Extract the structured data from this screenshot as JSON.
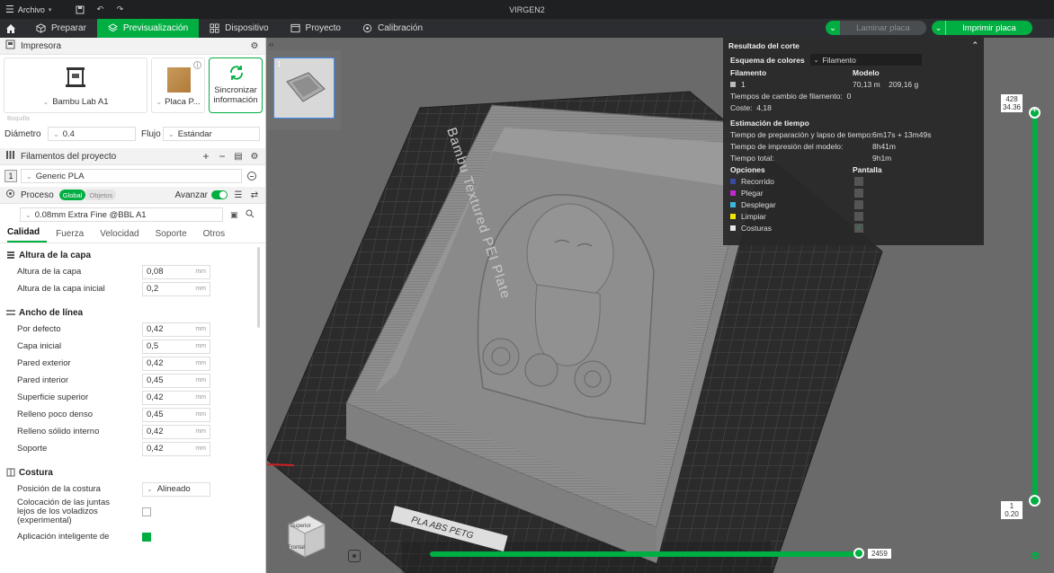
{
  "titlebar": {
    "menu_label": "Archivo",
    "title": "VIRGEN2"
  },
  "toolbar": {
    "tabs": [
      {
        "label": "Preparar"
      },
      {
        "label": "Previsualización"
      },
      {
        "label": "Dispositivo"
      },
      {
        "label": "Proyecto"
      },
      {
        "label": "Calibración"
      }
    ],
    "slice_label": "Laminar placa",
    "print_label": "Imprimir placa"
  },
  "printer": {
    "section_title": "Impresora",
    "printer_name": "Bambu Lab A1",
    "plate_name": "Placa P...",
    "sync_label_1": "Sincronizar",
    "sync_label_2": "información",
    "nozzle_label": "Boquilla",
    "diameter_label": "Diámetro",
    "diameter_value": "0.4",
    "flow_label": "Flujo",
    "flow_value": "Estándar"
  },
  "filaments": {
    "section_title": "Filamentos del proyecto",
    "items": [
      {
        "index": "1",
        "name": "Generic PLA"
      }
    ]
  },
  "process": {
    "section_title": "Proceso",
    "toggle_global": "Global",
    "toggle_objects": "Objetos",
    "advanced_label": "Avanzar",
    "profile": "0.08mm Extra Fine @BBL A1",
    "tabs": [
      "Calidad",
      "Fuerza",
      "Velocidad",
      "Soporte",
      "Otros"
    ]
  },
  "params": {
    "layer_height": {
      "title": "Altura de la capa",
      "rows": [
        {
          "label": "Altura de la capa",
          "value": "0,08",
          "unit": "mm"
        },
        {
          "label": "Altura de la capa inicial",
          "value": "0,2",
          "unit": "mm"
        }
      ]
    },
    "line_width": {
      "title": "Ancho de línea",
      "rows": [
        {
          "label": "Por defecto",
          "value": "0,42",
          "unit": "mm"
        },
        {
          "label": "Capa inicial",
          "value": "0,5",
          "unit": "mm"
        },
        {
          "label": "Pared exterior",
          "value": "0,42",
          "unit": "mm"
        },
        {
          "label": "Pared interior",
          "value": "0,45",
          "unit": "mm"
        },
        {
          "label": "Superficie superior",
          "value": "0,42",
          "unit": "mm"
        },
        {
          "label": "Relleno poco denso",
          "value": "0,45",
          "unit": "mm"
        },
        {
          "label": "Relleno sólido interno",
          "value": "0,42",
          "unit": "mm"
        },
        {
          "label": "Soporte",
          "value": "0,42",
          "unit": "mm"
        }
      ]
    },
    "seam": {
      "title": "Costura",
      "position_label": "Posición de la costura",
      "position_value": "Alineado",
      "staggered_label_1": "Colocación de las juntas",
      "staggered_label_2": "lejos de los voladizos",
      "staggered_label_3": "(experimental)",
      "smart_label": "Aplicación inteligente de"
    }
  },
  "viewport": {
    "thumb_index": "1",
    "plate_text": "Bambu Textured PEI Plate",
    "plate_sticker": "PLA ABS PETG",
    "cube_top": "Superior",
    "cube_front": "Frontal",
    "layer_top": "428",
    "layer_top_height": "34.36",
    "layer_bottom": "1",
    "layer_bottom_height": "0.20",
    "move_value": "2459"
  },
  "result": {
    "title": "Resultado del corte",
    "scheme_label": "Esquema de colores",
    "scheme_value": "Filamento",
    "col_filament": "Filamento",
    "col_model": "Modelo",
    "filament_index": "1",
    "filament_model": "70,13 m    209,16 g",
    "change_times": "Tiempos de cambio de filamento:  0",
    "cost": "Coste:  4,18",
    "time_title": "Estimación de tiempo",
    "prep_label": "Tiempo de preparación y lapso de tiempo:",
    "prep_value": "6m17s + 13m49s",
    "model_time_label": "Tiempo de impresión del modelo:",
    "model_time_value": "8h41m",
    "total_label": "Tiempo total:",
    "total_value": "9h1m",
    "options_label": "Opciones",
    "display_label": "Pantalla",
    "options": [
      {
        "label": "Recorrido",
        "color": "#3a4aa0"
      },
      {
        "label": "Plegar",
        "color": "#c02ad0"
      },
      {
        "label": "Desplegar",
        "color": "#39b8d8"
      },
      {
        "label": "Limpiar",
        "color": "#f2e600"
      },
      {
        "label": "Costuras",
        "color": "#e8e8e8"
      }
    ]
  },
  "colors": {
    "accent": "#00ae42"
  }
}
